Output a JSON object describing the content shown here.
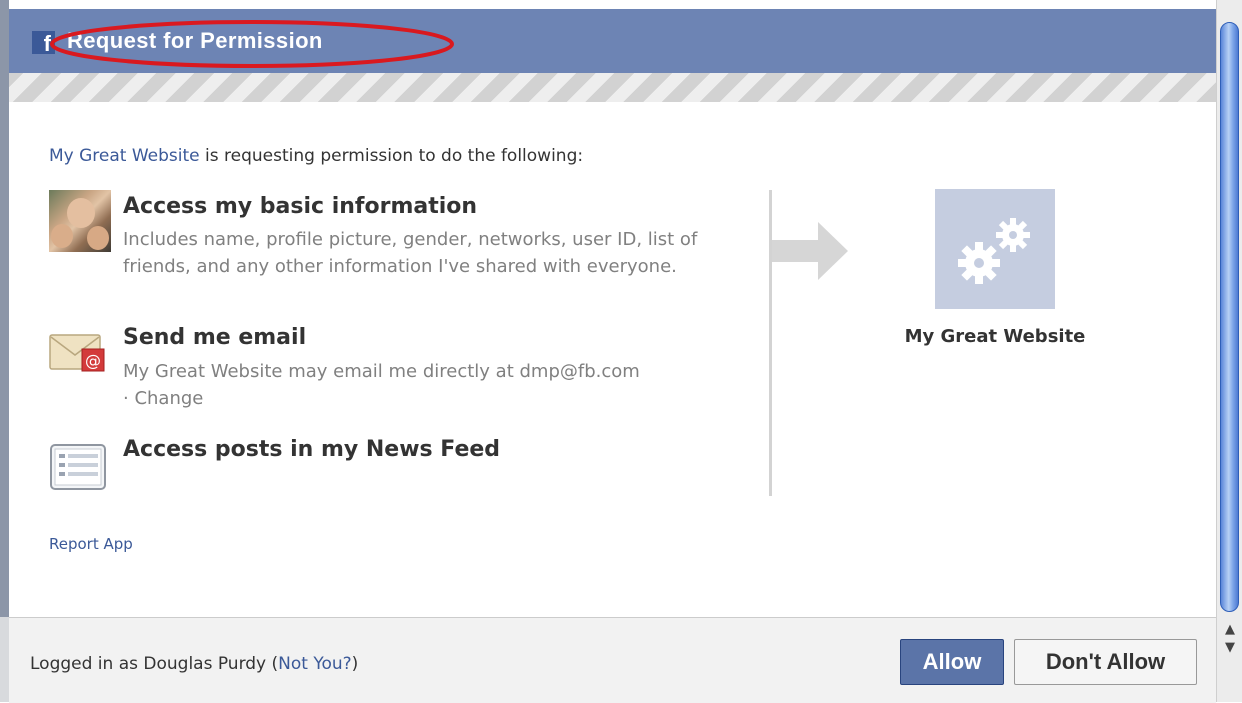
{
  "header": {
    "fb_logo": "f",
    "title": "Request for Permission"
  },
  "intro": {
    "site_name": "My Great Website",
    "text": " is requesting permission to do the following:"
  },
  "permissions": [
    {
      "icon": "profile-photo-icon",
      "title": "Access my basic information",
      "description": "Includes name, profile picture, gender, networks, user ID, list of friends, and any other information I've shared with everyone."
    },
    {
      "icon": "email-envelope-icon",
      "title": "Send me email",
      "description": "My Great Website may email me directly at dmp@fb.com",
      "link_prefix": "· ",
      "link": "Change"
    },
    {
      "icon": "news-feed-icon",
      "title": "Access posts in my News Feed"
    }
  ],
  "app": {
    "icon": "gears-icon",
    "name": "My Great Website"
  },
  "report_link": "Report App",
  "footer": {
    "logged_in_prefix": "Logged in as Douglas Purdy (",
    "not_you_link": "Not You?",
    "logged_in_suffix": ")",
    "allow_label": "Allow",
    "dont_allow_label": "Don't Allow"
  },
  "scrollbar": {
    "up_arrow": "▲",
    "down_arrow": "▼"
  },
  "colors": {
    "header_bg": "#6d84b4",
    "link": "#3b5998",
    "highlight": "#d9191f",
    "allow_bg": "#5b74a8"
  }
}
